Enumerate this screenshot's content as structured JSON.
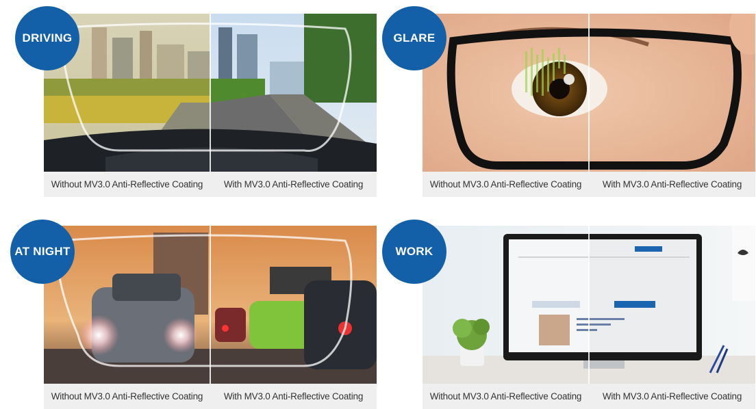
{
  "panels": [
    {
      "badge": "DRIVING",
      "caption_left": "Without MV3.0 Anti-Reflective Coating",
      "caption_right": "With MV3.0 Anti-Reflective Coating"
    },
    {
      "badge": "GLARE",
      "caption_left": "Without MV3.0 Anti-Reflective Coating",
      "caption_right": "With MV3.0 Anti-Reflective Coating"
    },
    {
      "badge": "AT NIGHT",
      "caption_left": "Without MV3.0 Anti-Reflective Coating",
      "caption_right": "With MV3.0 Anti-Reflective Coating"
    },
    {
      "badge": "WORK",
      "caption_left": "Without MV3.0 Anti-Reflective Coating",
      "caption_right": "With MV3.0 Anti-Reflective Coating"
    }
  ],
  "colors": {
    "badge": "#1360a8",
    "caption_bar": "#f0efef",
    "caption_text": "#333333"
  }
}
